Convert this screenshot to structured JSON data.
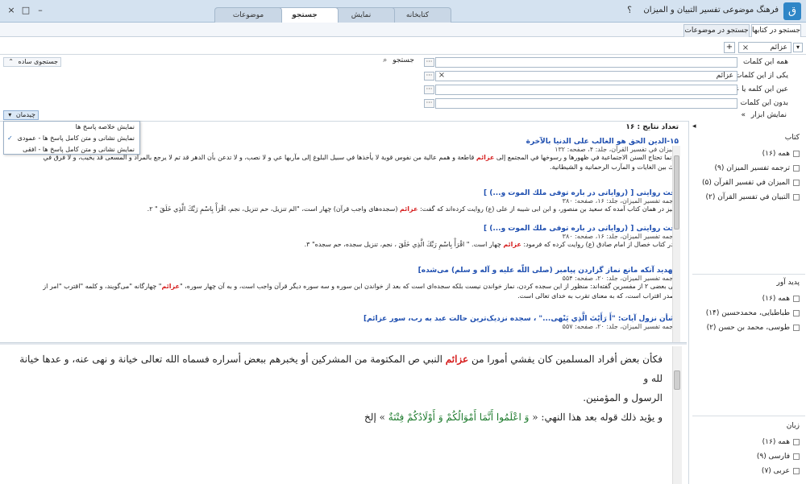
{
  "window": {
    "title": "فرهنگ موضوعی تفسیر التبیان و المیزان",
    "logo_glyph": "ق",
    "help_label": "؟",
    "min_label": "–",
    "max_label": "□",
    "close_label": "×"
  },
  "tabs": [
    "کتابخانه",
    "نمایش",
    "جستجو",
    "موضوعات"
  ],
  "subtabs": [
    "جستجو در کتابها",
    "جستجو در موضوعات"
  ],
  "search_chip": {
    "label": "عزائم",
    "close": "×",
    "dropdown": "▾"
  },
  "add_label": "+",
  "simple_search": "جستجوی ساده",
  "search_button": "جستجو",
  "fields": [
    {
      "label": "همه این کلمات",
      "value": ""
    },
    {
      "label": "یکی از این کلمات",
      "value": "عزائم"
    },
    {
      "label": "عین این کلمه یا عبارت",
      "value": ""
    },
    {
      "label": "بدون این کلمات",
      "value": ""
    }
  ],
  "tools_label": "نمایش ابزار",
  "layout_button": "چیدمان",
  "dropdown_items": [
    "نمایش خلاصه پاسخ ها",
    "نمایش نشانی و متن کامل پاسخ ها - عمودی",
    "نمایش نشانی و متن کامل پاسخ ها - افقی"
  ],
  "result_count": "تعداد نتایج : ۱۶",
  "results": [
    {
      "title": "۱۵-الدین الحق هو الغالب علی الدنیا بالآخرة",
      "source": "المیزان في تفسیر القرآن، جلد: ۴، صفحه: ۱۳۲",
      "pre": "و إنما تحتاج السنن الاجتماعیة في ظهورها و رسوخها في المجتمع إلی ",
      "hit": "عزائم",
      "post": " قاطعة و همم عالیة من نفوس قویة لا یأخذها في سبیل البلوغ إلی مآربها عي و لا نصب، و لا تدعن بأن الدهر قد تم لا یرجع بالمراد و المسعی قد یخیب، و لا فرق في ذلك بین الغایات و المآرب الرحمانیة و الشیطانیة."
    },
    {
      "title": "بحث روایتی [ (روایاتی در باره توفی ملك الموت و...) ]",
      "source": "ترجمه تفسیر المیزان، جلد: ۱۶، صفحه: ۳۸۰",
      "pre": "و نیز در همان کتاب آمده که سعید بن منصور، و ابن ابی شیبه از علی (ع) روایت کرده‌اند که گفت: ",
      "hit": "عزائم",
      "post": " (سجده‌های واجب قرآن) چهار است، \"الم تنزیل، حم تنزیل، نجم، اقْرَأْ بِاسْمِ رَبِّكَ الَّذِي خَلَقَ \" ۲."
    },
    {
      "title": "بحث روایتی [ (روایاتی در باره توفی ملك الموت و...) ]",
      "source": "ترجمه تفسیر المیزان، جلد: ۱۶، صفحه: ۳۸۰",
      "pre": "و در کتاب خصال از امام صادق (ع) روایت کرده که فرمود: ",
      "hit": "عزائم",
      "post": " چهار است. \" اقْرَأْ بِاسْمِ رَبِّكَ الَّذِي خَلَقَ ، نجم، تنزیل سجده، حم سجده\" ۳."
    },
    {
      "title": "[تهدید آنکه مانع نماز گزاردن پیامبر (صلی اللّه علیه و آله و سلم) می‌شده]",
      "source": "ترجمه تفسیر المیزان، جلد: ۲۰، صفحه: ۵۵۴",
      "pre": "ولی بعضی ۲ از مفسرین گفته‌اند: منظور از این سجده کردن، نماز خواندن نیست بلکه سجده‌ای است که بعد از خواندن این سوره و سه سوره دیگر قرآن واجب است، و به آن چهار سوره، \"",
      "hit": "عزائم",
      "post": "\" چهارگانه \"می‌گویند، و کلمه \"اقترب \"امر از مصدر اقتراب است، که به معنای تقرب به خدای تعالی است."
    },
    {
      "title": "[شأن نزول آیات: \"أَ رَأَیْتَ الَّذِي یَنْهی...\" ، سجده نزدیک‌ترین حالت عبد به رب، سور عزائم]",
      "source": "ترجمه تفسیر المیزان، جلد: ۲۰، صفحه: ۵۵۷",
      "pre": "",
      "hit": "",
      "post": ""
    }
  ],
  "right_panel": {
    "arrow": "◂",
    "groups": [
      {
        "title": "کتاب",
        "items": [
          "همه (۱۶)",
          "ترجمه تفسیر المیزان (۹)",
          "المیزان في تفسیر القرآن (۵)",
          "التبیان في تفسیر القرآن (۲)"
        ]
      },
      {
        "title": "پدید آور",
        "items": [
          "همه (۱۶)",
          "طباطبایی، محمدحسین (۱۴)",
          "طوسی، محمد بن حسن (۲)"
        ]
      },
      {
        "title": "زبان",
        "items": [
          "همه (۱۶)",
          "فارسی (۹)",
          "عربی (۷)"
        ]
      }
    ]
  },
  "detail": {
    "line1_pre": "فكأن بعض أفراد المسلمین كان یفشي أمورا من ",
    "line1_hit": "عزائم",
    "line1_post": " النبي ص المكتومة من المشركین أو یخبرهم ببعض أسراره فسماه الله تعالی خیانة و نهی عنه، و عدها خیانة لله و",
    "line2": "الرسول و المؤمنین.",
    "line3_pre": "و یؤید ذلك قوله بعد هذا النهي: « ",
    "line3_ayah": "وَ اعْلَمُوا أَنَّمَا أَمْوَالُكُمْ وَ أَوْلَادُكُمْ فِتْنَةٌ",
    "line3_post": " » إلخ"
  },
  "glyphs": {
    "search": "⌕",
    "dots": "···",
    "remove": "×",
    "check": "✓",
    "double_arrow": "»",
    "collapse": "⌃"
  }
}
